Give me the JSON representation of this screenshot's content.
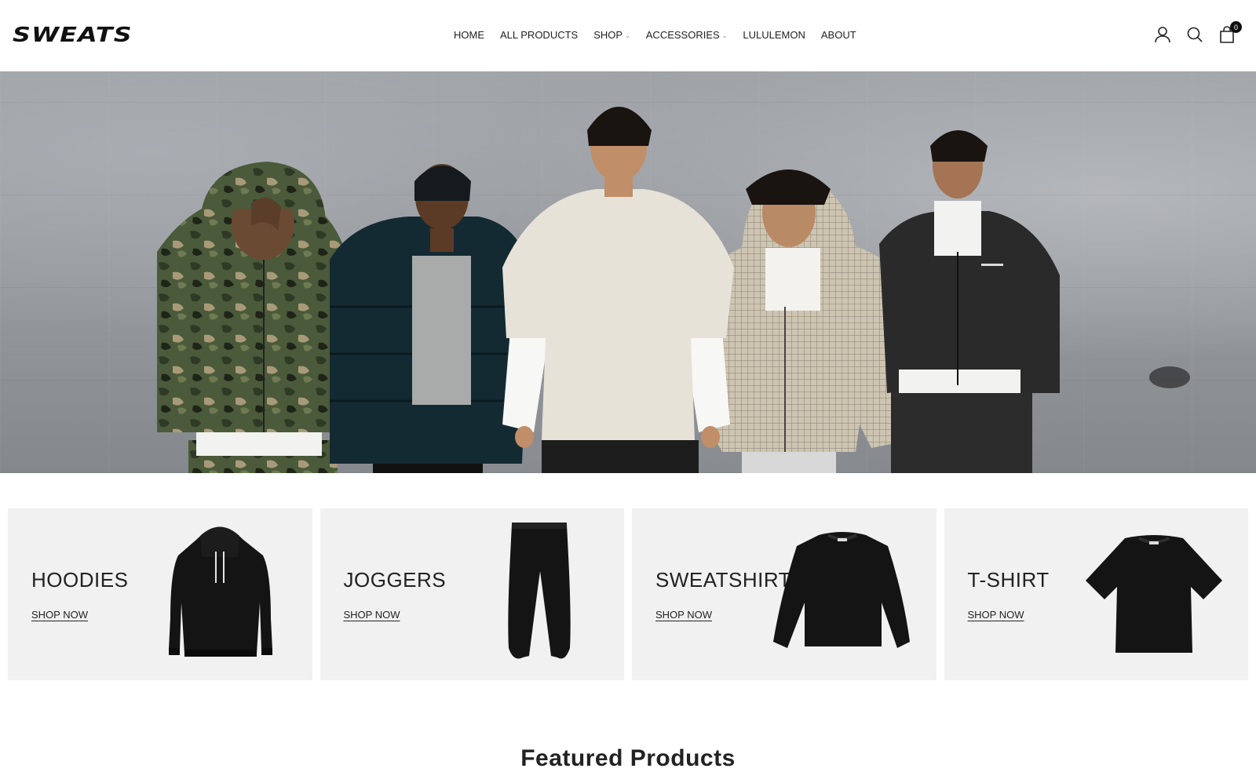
{
  "header": {
    "logo": "SWEATS",
    "nav": [
      {
        "label": "HOME",
        "dropdown": false
      },
      {
        "label": "ALL PRODUCTS",
        "dropdown": false
      },
      {
        "label": "SHOP",
        "dropdown": true
      },
      {
        "label": "ACCESSORIES",
        "dropdown": true
      },
      {
        "label": "LULULEMON",
        "dropdown": false
      },
      {
        "label": "ABOUT",
        "dropdown": false
      }
    ],
    "icons": [
      "user-icon",
      "search-icon",
      "cart-icon"
    ],
    "cart_count": "0"
  },
  "hero": {
    "models": [
      "camo-hoodie",
      "puffer-jacket",
      "oversized-tee",
      "check-zip-hoodie",
      "track-jacket"
    ]
  },
  "categories": [
    {
      "title": "HOODIES",
      "link": "SHOP NOW",
      "product": "hoodie"
    },
    {
      "title": "JOGGERS",
      "link": "SHOP NOW",
      "product": "joggers"
    },
    {
      "title": "SWEATSHIRT",
      "link": "SHOP NOW",
      "product": "sweatshirt"
    },
    {
      "title": "T-SHIRT",
      "link": "SHOP NOW",
      "product": "tshirt"
    }
  ],
  "featured": {
    "title": "Featured Products"
  },
  "colors": {
    "accent": "#111111",
    "tile_bg": "#f1f1f1"
  }
}
